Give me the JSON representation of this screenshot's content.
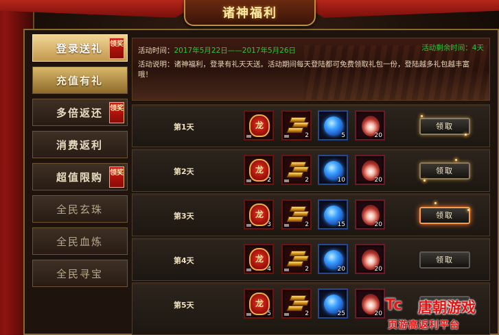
{
  "title": "诸神福利",
  "sidebar": {
    "items": [
      {
        "label": "登录送礼",
        "badge": "领奖"
      },
      {
        "label": "充值有礼",
        "badge": ""
      },
      {
        "label": "多倍返还",
        "badge": "领奖"
      },
      {
        "label": "消费返利",
        "badge": ""
      },
      {
        "label": "超值限购",
        "badge": "领奖"
      },
      {
        "label": "全民玄珠",
        "badge": ""
      },
      {
        "label": "全民血炼",
        "badge": ""
      },
      {
        "label": "全民寻宝",
        "badge": ""
      }
    ]
  },
  "info": {
    "time_label": "活动时间：",
    "time_value": "2017年5月22日——2017年5月26日",
    "remaining": "活动剩余时间：4天",
    "description": "活动说明：诸神福利，登录有礼天天送。活动期间每天登陆都可免费领取礼包一份，登陆越多礼包越丰富哦！"
  },
  "days": [
    {
      "label": "第1天",
      "counts": [
        "",
        "2",
        "5",
        "20"
      ],
      "claim": "领取"
    },
    {
      "label": "第2天",
      "counts": [
        "2",
        "2",
        "10",
        "20"
      ],
      "claim": "领取"
    },
    {
      "label": "第3天",
      "counts": [
        "3",
        "2",
        "15",
        "20"
      ],
      "claim": "领取"
    },
    {
      "label": "第4天",
      "counts": [
        "4",
        "2",
        "20",
        "20"
      ],
      "claim": "领取"
    },
    {
      "label": "第5天",
      "counts": [
        "5",
        "2",
        "25",
        "20"
      ],
      "claim": "领取"
    }
  ],
  "item_icons": [
    "red-seal-icon",
    "gold-bars-icon",
    "blue-orb-icon",
    "feather-orb-icon"
  ],
  "seal_glyph": "龙",
  "watermark": {
    "logo": "Tc",
    "name": "唐朝游戏",
    "slogan": "页游高返利平台"
  },
  "colors": {
    "accent_gold": "#e6b34a",
    "green_text": "#2fc53b",
    "badge_red": "#d21b14"
  }
}
